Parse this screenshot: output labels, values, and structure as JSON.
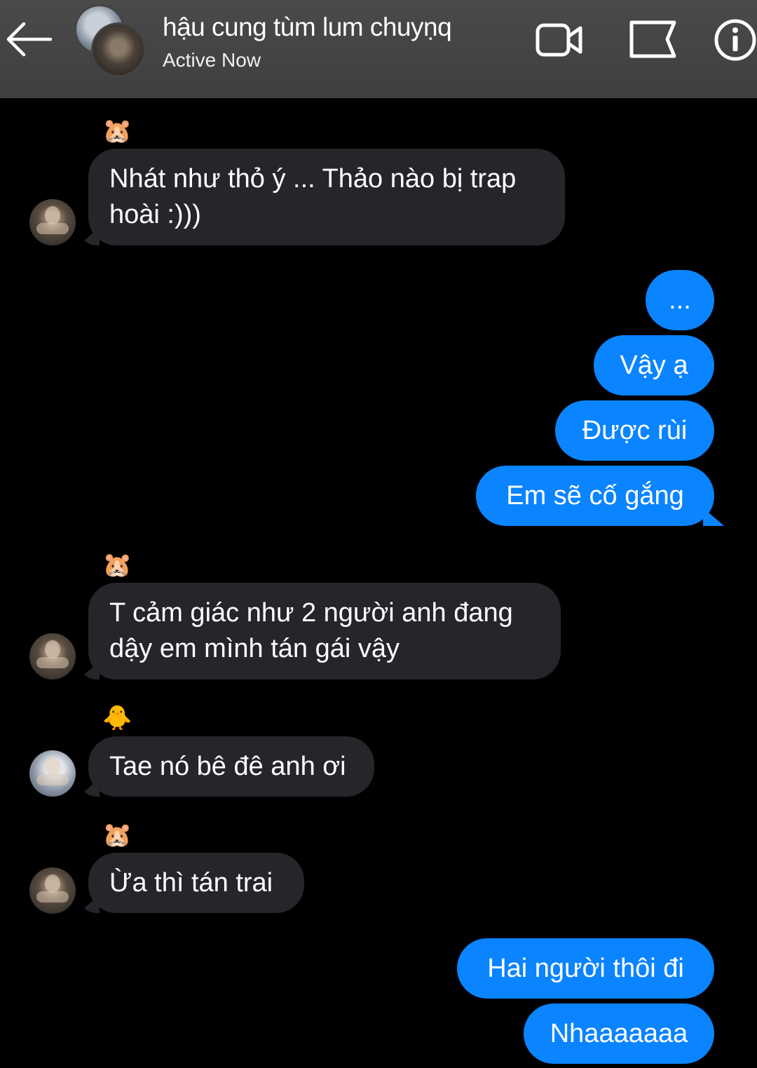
{
  "header": {
    "title": "hậu cung tùm lum chuyṇq",
    "status": "Active Now",
    "back_icon": "arrow-left-icon",
    "video_icon": "video-camera-icon",
    "flag_icon": "flag-icon",
    "info_icon": "info-icon"
  },
  "messages": [
    {
      "sender_emoji": "🐹",
      "text_line1": "Nhát như thỏ ý ... Thảo nào bị trap",
      "text_line2": "hoài :)))"
    },
    {
      "text": "..."
    },
    {
      "text": "Vậy ạ"
    },
    {
      "text": "Được rùi"
    },
    {
      "text": "Em sẽ cố gắng"
    },
    {
      "sender_emoji": "🐹",
      "text_line1": "T cảm giác như 2 người anh đang",
      "text_line2": "dậy em mình tán gái vậy"
    },
    {
      "sender_emoji": "🐥",
      "text": "Tae nó bê đê anh ơi"
    },
    {
      "sender_emoji": "🐹",
      "text": "Ừa thì tán trai"
    },
    {
      "text": "Hai người thôi đi"
    },
    {
      "text": "Nhaaaaaaa"
    }
  ],
  "colors": {
    "header_bg": "#444444",
    "incoming_bubble": "#26252a",
    "outgoing_bubble": "#0a84ff",
    "background": "#000000"
  }
}
